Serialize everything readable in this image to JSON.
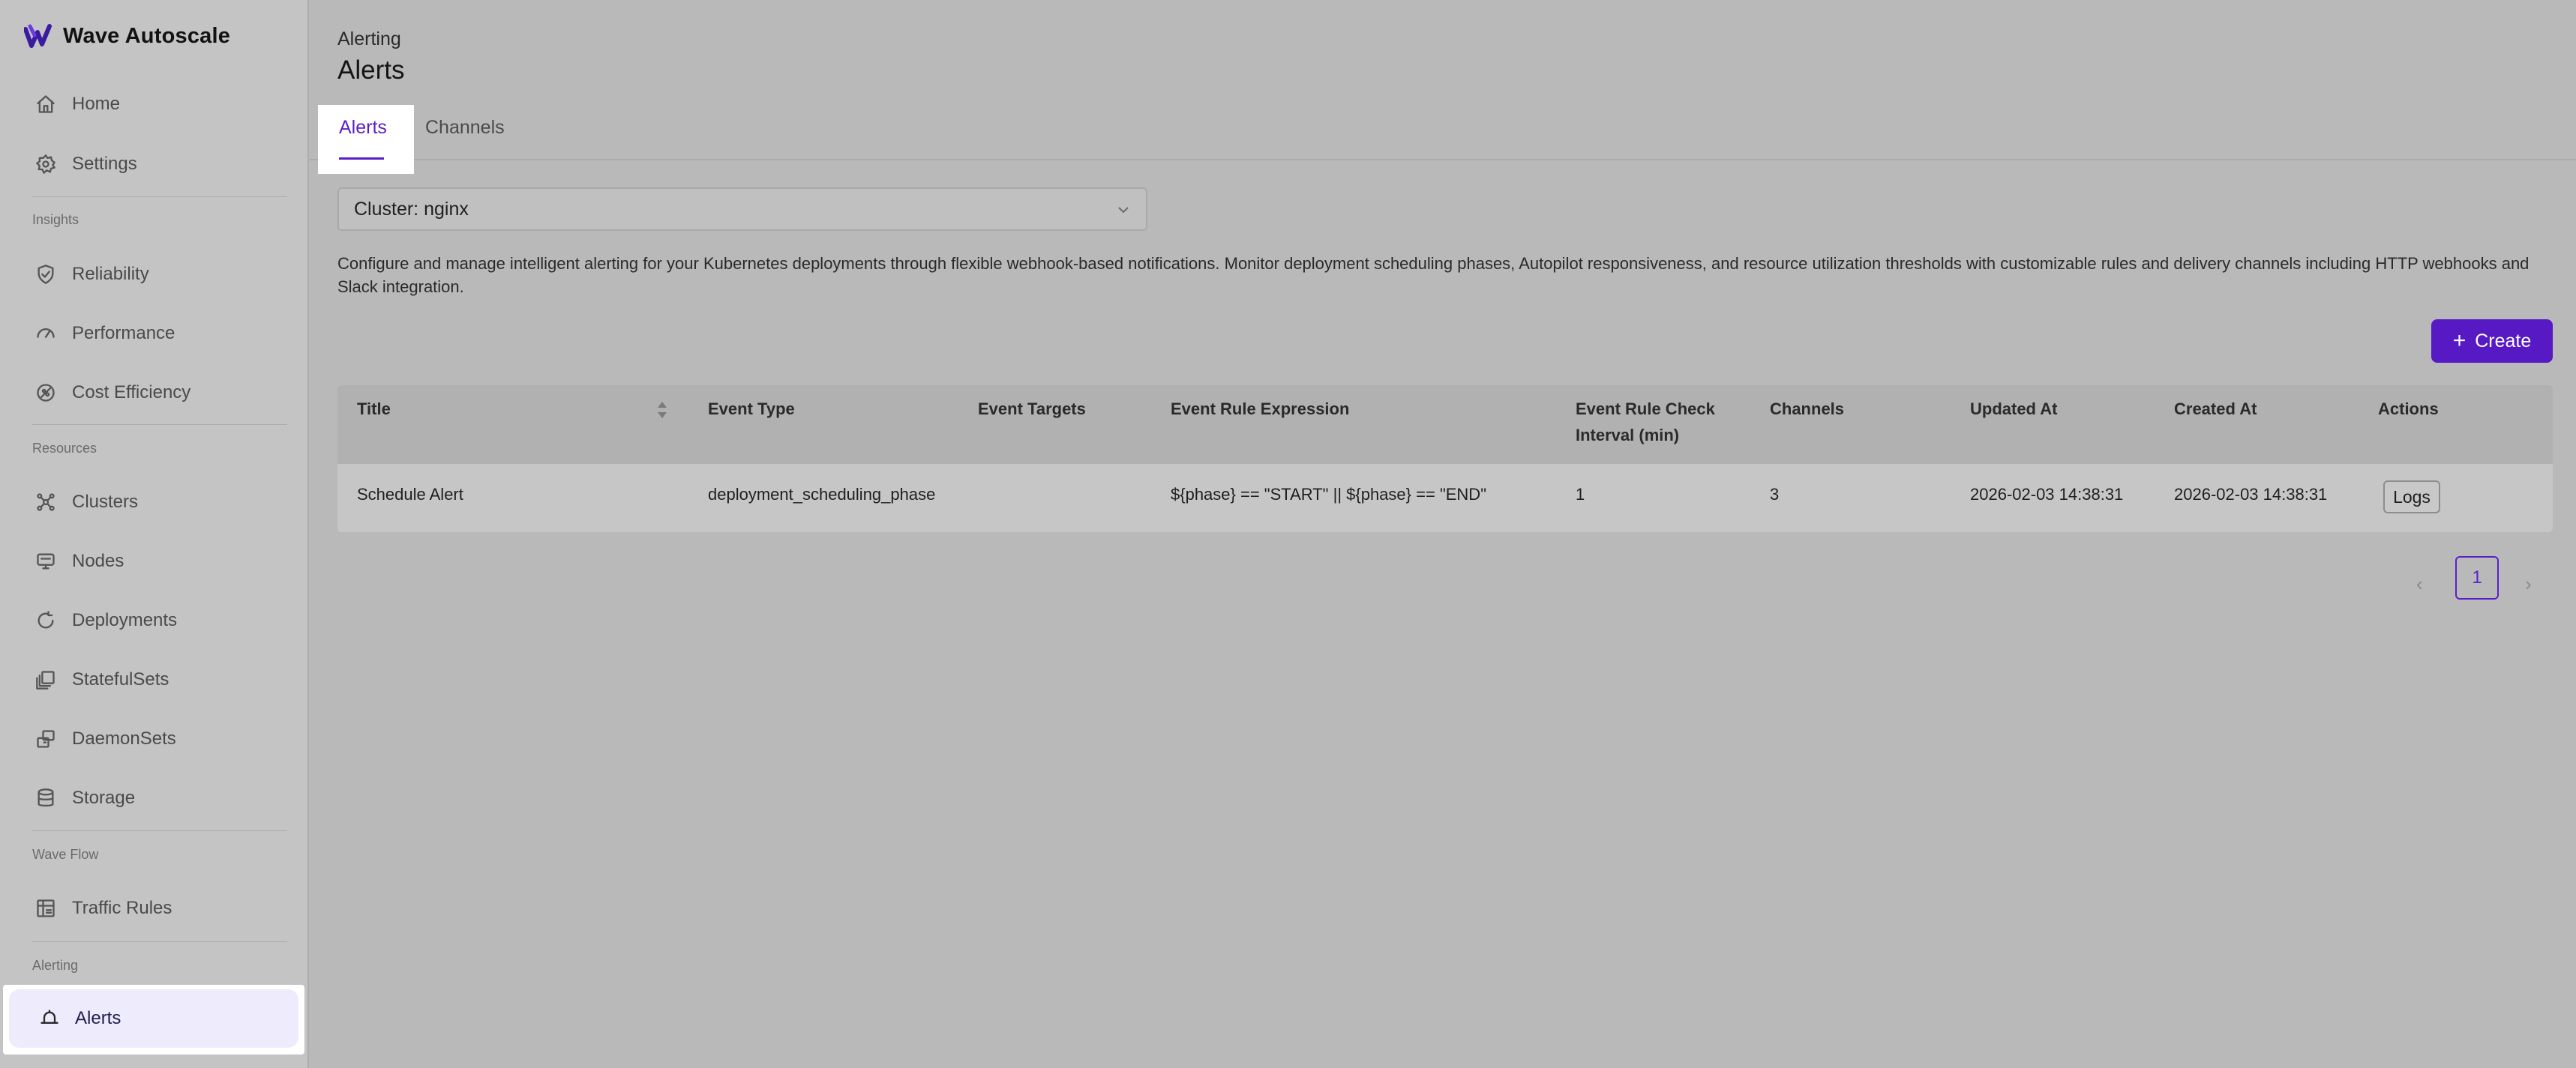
{
  "app": {
    "name": "Wave Autoscale",
    "accent": "#5719c4"
  },
  "sidebar": {
    "top_items": [
      {
        "label": "Home",
        "icon": "home-icon"
      },
      {
        "label": "Settings",
        "icon": "gear-icon"
      }
    ],
    "sections": [
      {
        "label": "Insights",
        "items": [
          {
            "label": "Reliability",
            "icon": "shield-icon"
          },
          {
            "label": "Performance",
            "icon": "gauge-icon"
          },
          {
            "label": "Cost Efficiency",
            "icon": "cost-icon"
          }
        ]
      },
      {
        "label": "Resources",
        "items": [
          {
            "label": "Clusters",
            "icon": "cluster-icon"
          },
          {
            "label": "Nodes",
            "icon": "node-icon"
          },
          {
            "label": "Deployments",
            "icon": "deployment-icon"
          },
          {
            "label": "StatefulSets",
            "icon": "statefulset-icon"
          },
          {
            "label": "DaemonSets",
            "icon": "daemonset-icon"
          },
          {
            "label": "Storage",
            "icon": "database-icon"
          }
        ]
      },
      {
        "label": "Wave Flow",
        "items": [
          {
            "label": "Traffic Rules",
            "icon": "traffic-rules-icon"
          }
        ]
      },
      {
        "label": "Alerting",
        "items": [
          {
            "label": "Alerts",
            "icon": "bell-icon",
            "active": true
          }
        ]
      }
    ]
  },
  "header": {
    "breadcrumb": "Alerting",
    "title": "Alerts",
    "tabs": [
      {
        "label": "Alerts",
        "active": true
      },
      {
        "label": "Channels",
        "active": false
      }
    ]
  },
  "main": {
    "cluster_select": "Cluster: nginx",
    "description": "Configure and manage intelligent alerting for your Kubernetes deployments through flexible webhook-based notifications. Monitor deployment scheduling phases, Autopilot responsiveness, and resource utilization thresholds with customizable rules and delivery channels including HTTP webhooks and Slack integration.",
    "create_label": "Create",
    "table": {
      "headers": {
        "title": "Title",
        "event_type": "Event Type",
        "event_targets": "Event Targets",
        "rule_expression": "Event Rule Expression",
        "check_interval_1": "Event Rule Check",
        "check_interval_2": "Interval (min)",
        "channels": "Channels",
        "updated_at": "Updated At",
        "created_at": "Created At",
        "actions": "Actions"
      },
      "rows": [
        {
          "title": "Schedule Alert",
          "event_type": "deployment_scheduling_phase",
          "event_targets": "",
          "rule_expression": "${phase} == \"START\" || ${phase} == \"END\"",
          "check_interval": "1",
          "channels": "3",
          "updated_at": "2026-02-03 14:38:31",
          "created_at": "2026-02-03 14:38:31",
          "action": "Logs"
        }
      ]
    },
    "pagination": {
      "prev": "‹",
      "current": "1",
      "next": "›"
    }
  }
}
